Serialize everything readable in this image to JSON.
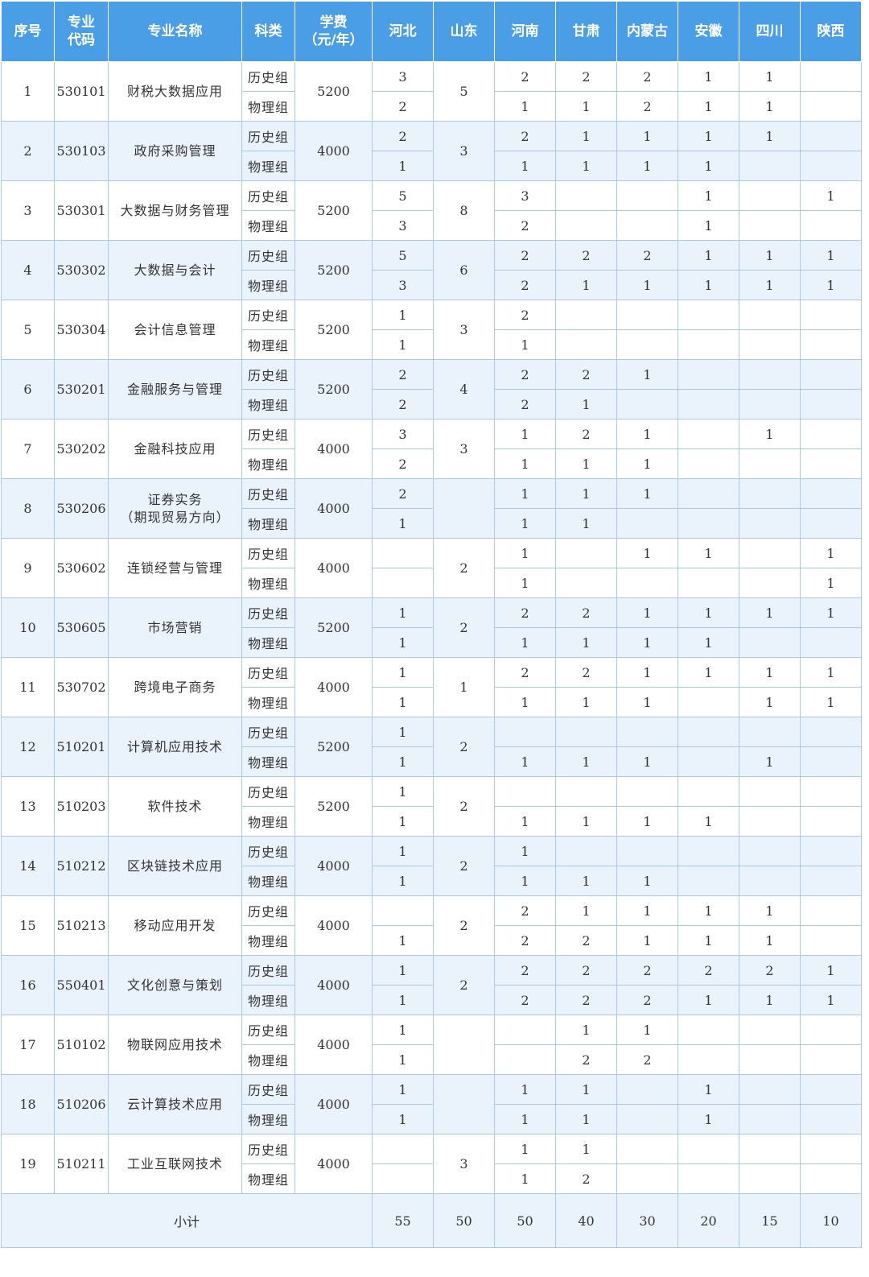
{
  "headers": [
    "序号",
    "专业\n代码",
    "专业名称",
    "科类",
    "学费\n（元/年）",
    "河北",
    "山东",
    "河南",
    "甘肃",
    "内蒙古",
    "安徽",
    "四川",
    "陕西"
  ],
  "rows": [
    {
      "no": "1",
      "code": "530101",
      "name": "财税大数据应用",
      "fee": "5200",
      "shandong": "5",
      "hist": {
        "hebei": "3",
        "henan": "2",
        "gansu": "2",
        "neimenggu": "2",
        "anhui": "1",
        "sichuan": "1",
        "shaanxi": ""
      },
      "phys": {
        "hebei": "2",
        "henan": "1",
        "gansu": "1",
        "neimenggu": "2",
        "anhui": "1",
        "sichuan": "1",
        "shaanxi": ""
      }
    },
    {
      "no": "2",
      "code": "530103",
      "name": "政府采购管理",
      "fee": "4000",
      "shandong": "3",
      "hist": {
        "hebei": "2",
        "henan": "2",
        "gansu": "1",
        "neimenggu": "1",
        "anhui": "1",
        "sichuan": "1",
        "shaanxi": ""
      },
      "phys": {
        "hebei": "1",
        "henan": "1",
        "gansu": "1",
        "neimenggu": "1",
        "anhui": "1",
        "sichuan": "",
        "shaanxi": ""
      }
    },
    {
      "no": "3",
      "code": "530301",
      "name": "大数据与财务管理",
      "fee": "5200",
      "shandong": "8",
      "hist": {
        "hebei": "5",
        "henan": "3",
        "gansu": "",
        "neimenggu": "",
        "anhui": "1",
        "sichuan": "",
        "shaanxi": "1"
      },
      "phys": {
        "hebei": "3",
        "henan": "2",
        "gansu": "",
        "neimenggu": "",
        "anhui": "1",
        "sichuan": "",
        "shaanxi": ""
      }
    },
    {
      "no": "4",
      "code": "530302",
      "name": "大数据与会计",
      "fee": "5200",
      "shandong": "6",
      "hist": {
        "hebei": "5",
        "henan": "2",
        "gansu": "2",
        "neimenggu": "2",
        "anhui": "1",
        "sichuan": "1",
        "shaanxi": "1"
      },
      "phys": {
        "hebei": "3",
        "henan": "2",
        "gansu": "1",
        "neimenggu": "1",
        "anhui": "1",
        "sichuan": "1",
        "shaanxi": "1"
      }
    },
    {
      "no": "5",
      "code": "530304",
      "name": "会计信息管理",
      "fee": "5200",
      "shandong": "3",
      "hist": {
        "hebei": "1",
        "henan": "2",
        "gansu": "",
        "neimenggu": "",
        "anhui": "",
        "sichuan": "",
        "shaanxi": ""
      },
      "phys": {
        "hebei": "1",
        "henan": "1",
        "gansu": "",
        "neimenggu": "",
        "anhui": "",
        "sichuan": "",
        "shaanxi": ""
      }
    },
    {
      "no": "6",
      "code": "530201",
      "name": "金融服务与管理",
      "fee": "5200",
      "shandong": "4",
      "hist": {
        "hebei": "2",
        "henan": "2",
        "gansu": "2",
        "neimenggu": "1",
        "anhui": "",
        "sichuan": "",
        "shaanxi": ""
      },
      "phys": {
        "hebei": "2",
        "henan": "2",
        "gansu": "1",
        "neimenggu": "",
        "anhui": "",
        "sichuan": "",
        "shaanxi": ""
      }
    },
    {
      "no": "7",
      "code": "530202",
      "name": "金融科技应用",
      "fee": "4000",
      "shandong": "3",
      "hist": {
        "hebei": "3",
        "henan": "1",
        "gansu": "2",
        "neimenggu": "1",
        "anhui": "",
        "sichuan": "1",
        "shaanxi": ""
      },
      "phys": {
        "hebei": "2",
        "henan": "1",
        "gansu": "1",
        "neimenggu": "1",
        "anhui": "",
        "sichuan": "",
        "shaanxi": ""
      }
    },
    {
      "no": "8",
      "code": "530206",
      "name": "证券实务\n（期现贸易方向）",
      "fee": "4000",
      "shandong": "",
      "hist": {
        "hebei": "2",
        "henan": "1",
        "gansu": "1",
        "neimenggu": "1",
        "anhui": "",
        "sichuan": "",
        "shaanxi": ""
      },
      "phys": {
        "hebei": "1",
        "henan": "1",
        "gansu": "1",
        "neimenggu": "",
        "anhui": "",
        "sichuan": "",
        "shaanxi": ""
      }
    },
    {
      "no": "9",
      "code": "530602",
      "name": "连锁经营与管理",
      "fee": "4000",
      "shandong": "2",
      "hist": {
        "hebei": "",
        "henan": "1",
        "gansu": "",
        "neimenggu": "1",
        "anhui": "1",
        "sichuan": "",
        "shaanxi": "1"
      },
      "phys": {
        "hebei": "",
        "henan": "1",
        "gansu": "",
        "neimenggu": "",
        "anhui": "",
        "sichuan": "",
        "shaanxi": "1"
      }
    },
    {
      "no": "10",
      "code": "530605",
      "name": "市场营销",
      "fee": "5200",
      "shandong": "2",
      "hist": {
        "hebei": "1",
        "henan": "2",
        "gansu": "2",
        "neimenggu": "1",
        "anhui": "1",
        "sichuan": "1",
        "shaanxi": "1"
      },
      "phys": {
        "hebei": "1",
        "henan": "1",
        "gansu": "1",
        "neimenggu": "1",
        "anhui": "1",
        "sichuan": "",
        "shaanxi": ""
      }
    },
    {
      "no": "11",
      "code": "530702",
      "name": "跨境电子商务",
      "fee": "4000",
      "shandong": "1",
      "hist": {
        "hebei": "1",
        "henan": "2",
        "gansu": "2",
        "neimenggu": "1",
        "anhui": "1",
        "sichuan": "1",
        "shaanxi": "1"
      },
      "phys": {
        "hebei": "1",
        "henan": "1",
        "gansu": "1",
        "neimenggu": "1",
        "anhui": "",
        "sichuan": "1",
        "shaanxi": "1"
      }
    },
    {
      "no": "12",
      "code": "510201",
      "name": "计算机应用技术",
      "fee": "5200",
      "shandong": "2",
      "hist": {
        "hebei": "1",
        "henan": "",
        "gansu": "",
        "neimenggu": "",
        "anhui": "",
        "sichuan": "",
        "shaanxi": ""
      },
      "phys": {
        "hebei": "1",
        "henan": "1",
        "gansu": "1",
        "neimenggu": "1",
        "anhui": "",
        "sichuan": "1",
        "shaanxi": ""
      }
    },
    {
      "no": "13",
      "code": "510203",
      "name": "软件技术",
      "fee": "5200",
      "shandong": "2",
      "hist": {
        "hebei": "1",
        "henan": "",
        "gansu": "",
        "neimenggu": "",
        "anhui": "",
        "sichuan": "",
        "shaanxi": ""
      },
      "phys": {
        "hebei": "1",
        "henan": "1",
        "gansu": "1",
        "neimenggu": "1",
        "anhui": "1",
        "sichuan": "",
        "shaanxi": ""
      }
    },
    {
      "no": "14",
      "code": "510212",
      "name": "区块链技术应用",
      "fee": "4000",
      "shandong": "2",
      "hist": {
        "hebei": "1",
        "henan": "1",
        "gansu": "",
        "neimenggu": "",
        "anhui": "",
        "sichuan": "",
        "shaanxi": ""
      },
      "phys": {
        "hebei": "1",
        "henan": "1",
        "gansu": "1",
        "neimenggu": "1",
        "anhui": "",
        "sichuan": "",
        "shaanxi": ""
      }
    },
    {
      "no": "15",
      "code": "510213",
      "name": "移动应用开发",
      "fee": "4000",
      "shandong": "2",
      "hist": {
        "hebei": "",
        "henan": "2",
        "gansu": "1",
        "neimenggu": "1",
        "anhui": "1",
        "sichuan": "1",
        "shaanxi": ""
      },
      "phys": {
        "hebei": "1",
        "henan": "2",
        "gansu": "2",
        "neimenggu": "1",
        "anhui": "1",
        "sichuan": "1",
        "shaanxi": ""
      }
    },
    {
      "no": "16",
      "code": "550401",
      "name": "文化创意与策划",
      "fee": "4000",
      "shandong": "2",
      "hist": {
        "hebei": "1",
        "henan": "2",
        "gansu": "2",
        "neimenggu": "2",
        "anhui": "2",
        "sichuan": "2",
        "shaanxi": "1"
      },
      "phys": {
        "hebei": "1",
        "henan": "2",
        "gansu": "2",
        "neimenggu": "2",
        "anhui": "1",
        "sichuan": "1",
        "shaanxi": "1"
      }
    },
    {
      "no": "17",
      "code": "510102",
      "name": "物联网应用技术",
      "fee": "4000",
      "shandong": "",
      "hist": {
        "hebei": "1",
        "henan": "",
        "gansu": "1",
        "neimenggu": "1",
        "anhui": "",
        "sichuan": "",
        "shaanxi": ""
      },
      "phys": {
        "hebei": "1",
        "henan": "",
        "gansu": "2",
        "neimenggu": "2",
        "anhui": "",
        "sichuan": "",
        "shaanxi": ""
      }
    },
    {
      "no": "18",
      "code": "510206",
      "name": "云计算技术应用",
      "fee": "4000",
      "shandong": "",
      "hist": {
        "hebei": "1",
        "henan": "1",
        "gansu": "1",
        "neimenggu": "",
        "anhui": "1",
        "sichuan": "",
        "shaanxi": ""
      },
      "phys": {
        "hebei": "1",
        "henan": "1",
        "gansu": "1",
        "neimenggu": "",
        "anhui": "1",
        "sichuan": "",
        "shaanxi": ""
      }
    },
    {
      "no": "19",
      "code": "510211",
      "name": "工业互联网技术",
      "fee": "4000",
      "shandong": "3",
      "hist": {
        "hebei": "",
        "henan": "1",
        "gansu": "1",
        "neimenggu": "",
        "anhui": "",
        "sichuan": "",
        "shaanxi": ""
      },
      "phys": {
        "hebei": "",
        "henan": "1",
        "gansu": "2",
        "neimenggu": "",
        "anhui": "",
        "sichuan": "",
        "shaanxi": ""
      }
    }
  ],
  "subject_hist": "历史组",
  "subject_phys": "物理组",
  "subtotal": {
    "label": "小计",
    "hebei": "55",
    "shandong": "50",
    "henan": "50",
    "gansu": "40",
    "neimenggu": "30",
    "anhui": "20",
    "sichuan": "15",
    "shaanxi": "10"
  },
  "colors": {
    "header_bg": "#4a9ee6",
    "alt_row_bg": "#eaf3fc",
    "border": "#a9c8ea"
  }
}
